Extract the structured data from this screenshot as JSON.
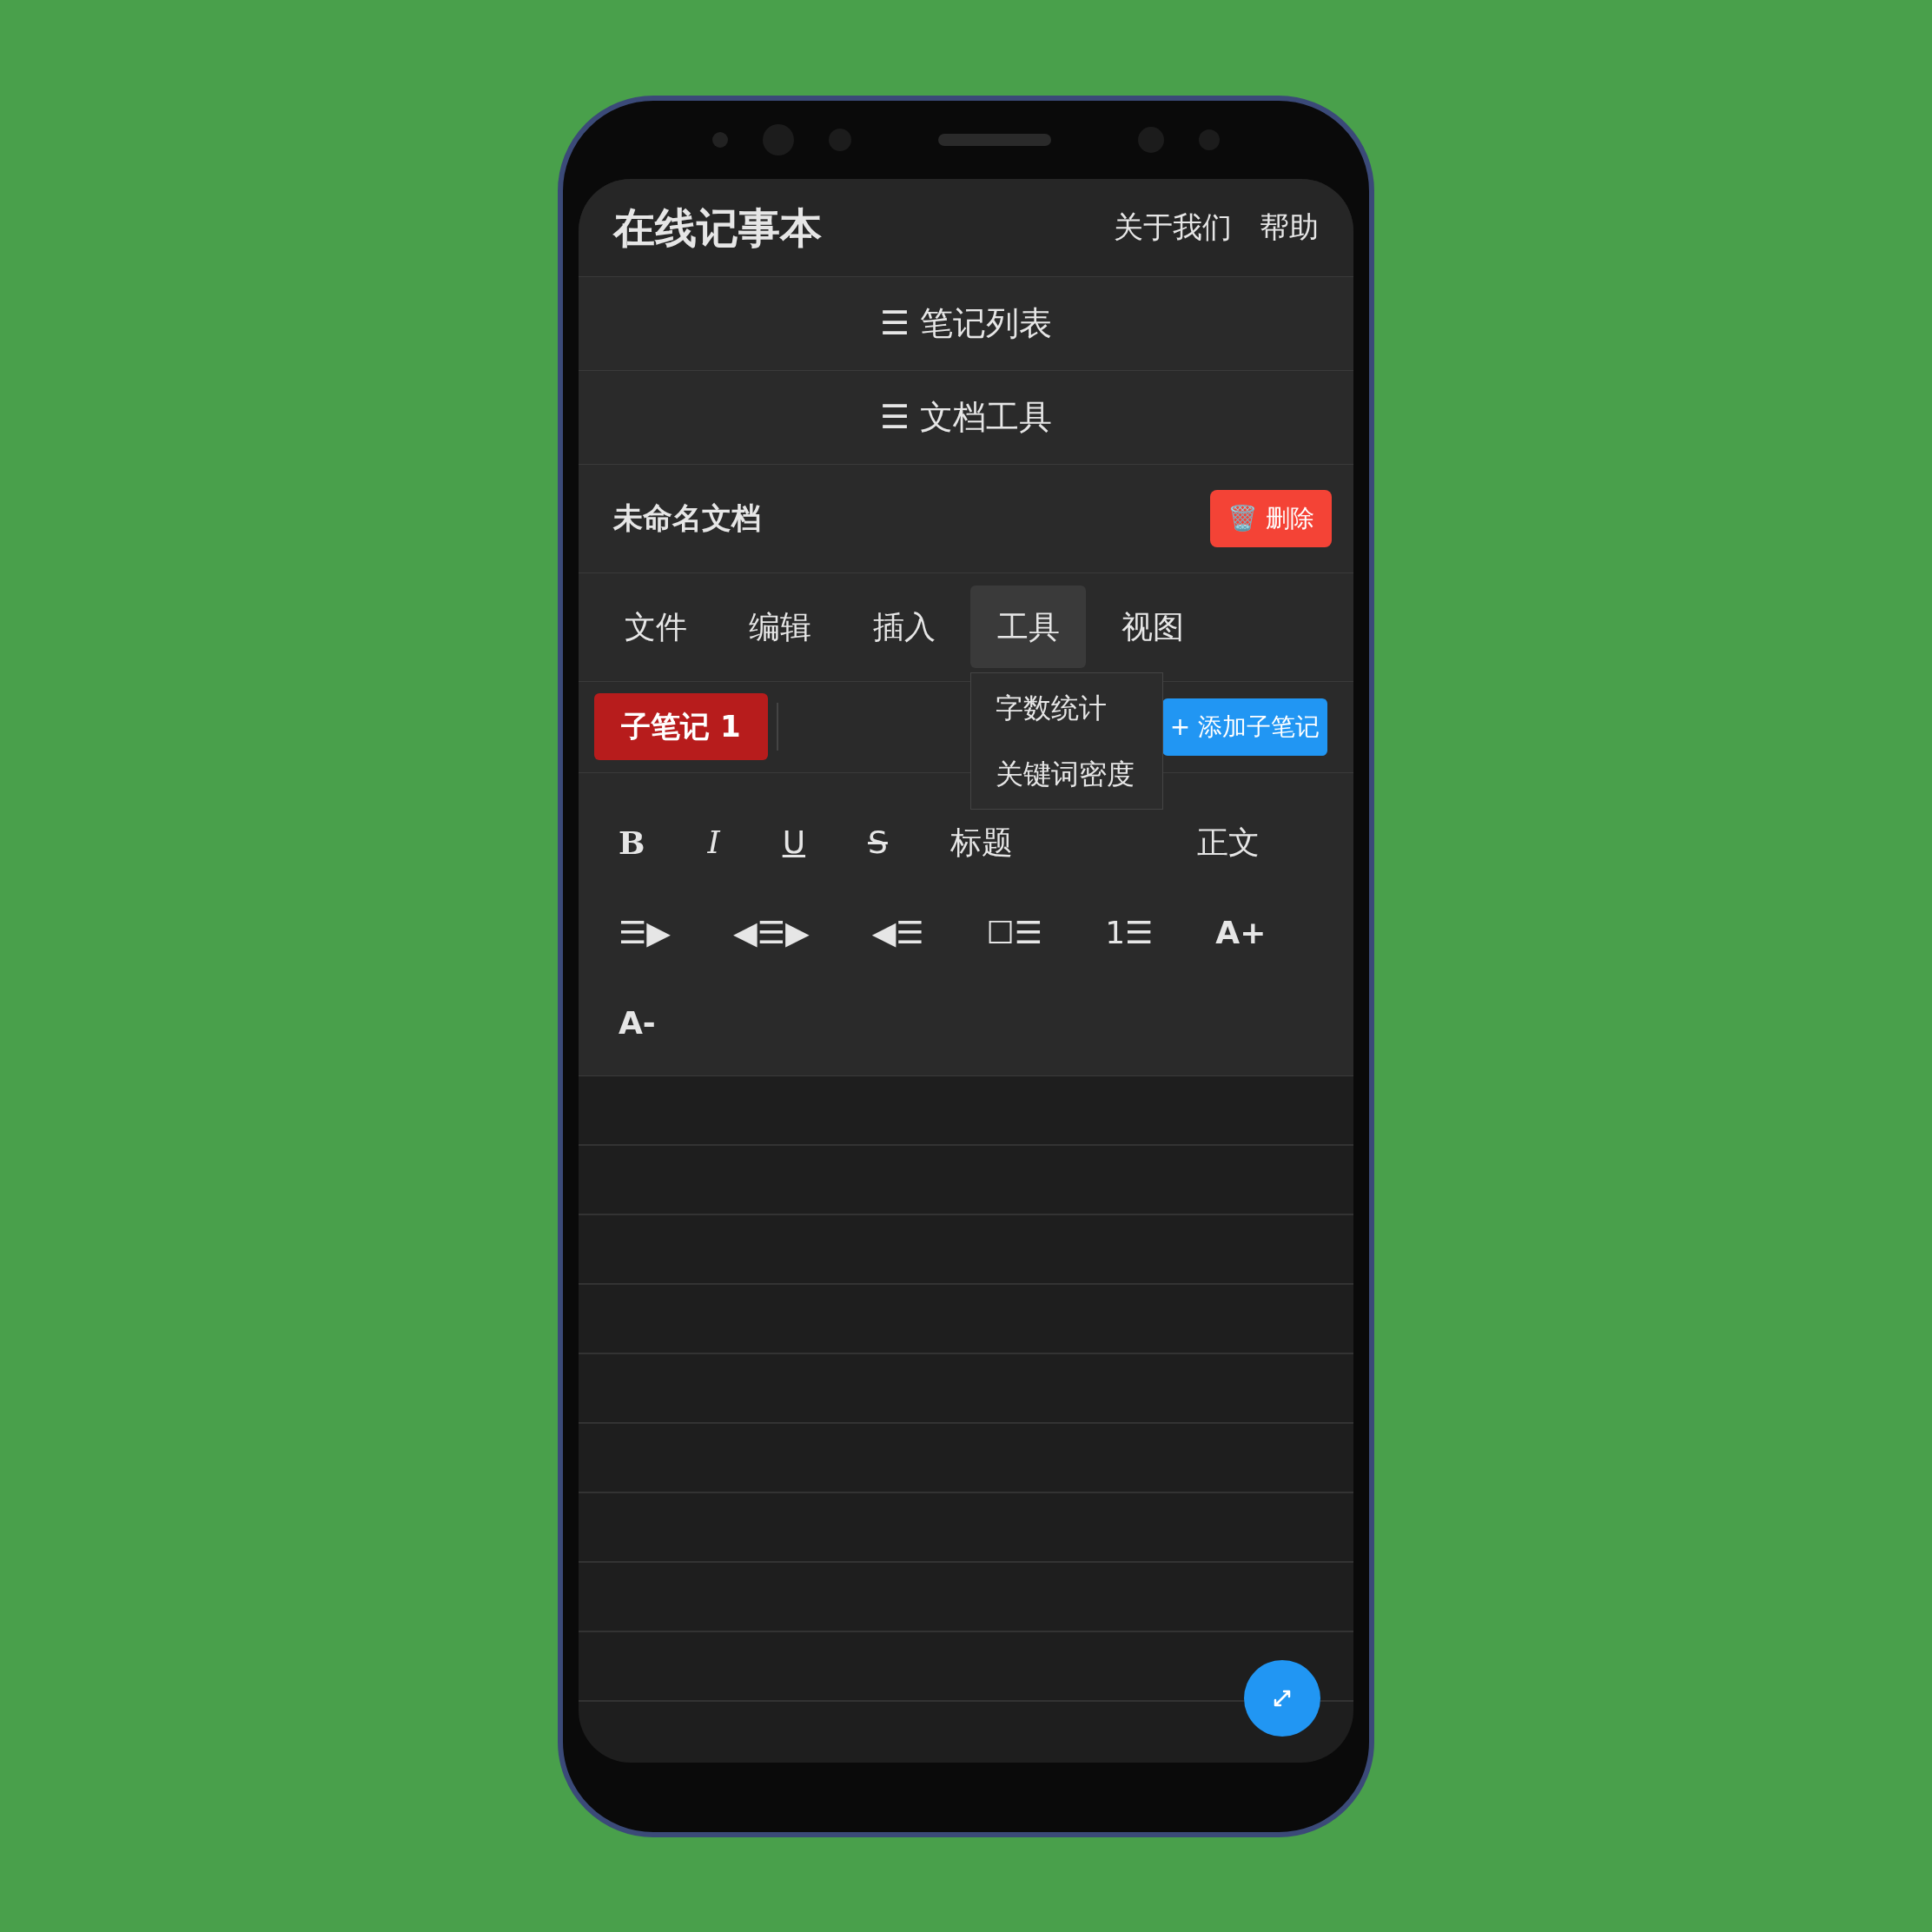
{
  "header": {
    "title": "在线记事本",
    "links": [
      "关于我们",
      "帮助"
    ]
  },
  "sections": [
    "☰ 笔记列表",
    "☰ 文档工具"
  ],
  "document": {
    "title": "未命名文档",
    "delete_button": "🗑️ 删除"
  },
  "menu_tabs": [
    {
      "label": "文件",
      "selected": false
    },
    {
      "label": "编辑",
      "selected": false
    },
    {
      "label": "插入",
      "selected": false
    },
    {
      "label": "工具",
      "selected": true,
      "dropdown": [
        "字数统计",
        "关键词密度"
      ]
    },
    {
      "label": "视图",
      "selected": false
    }
  ],
  "sub_notes": [
    {
      "label": "子笔记 1",
      "selected": true
    }
  ],
  "add_sub_note": "+ 添加子笔记",
  "toolbar": [
    {
      "label": "B",
      "kind": "bold"
    },
    {
      "label": "I",
      "kind": "italic"
    },
    {
      "label": "U",
      "kind": "underline"
    },
    {
      "label": "S",
      "kind": "strike"
    },
    {
      "label": "标题",
      "kind": "text"
    },
    {
      "label": "正文",
      "kind": "text"
    },
    {
      "label": "☰▶",
      "kind": "symbol"
    },
    {
      "label": "◀☰▶",
      "kind": "symbol"
    },
    {
      "label": "◀☰",
      "kind": "symbol"
    },
    {
      "label": "☐☰",
      "kind": "symbol"
    },
    {
      "label": "1☰",
      "kind": "symbol"
    },
    {
      "label": "A+",
      "kind": "size"
    },
    {
      "label": "A-",
      "kind": "size"
    }
  ]
}
